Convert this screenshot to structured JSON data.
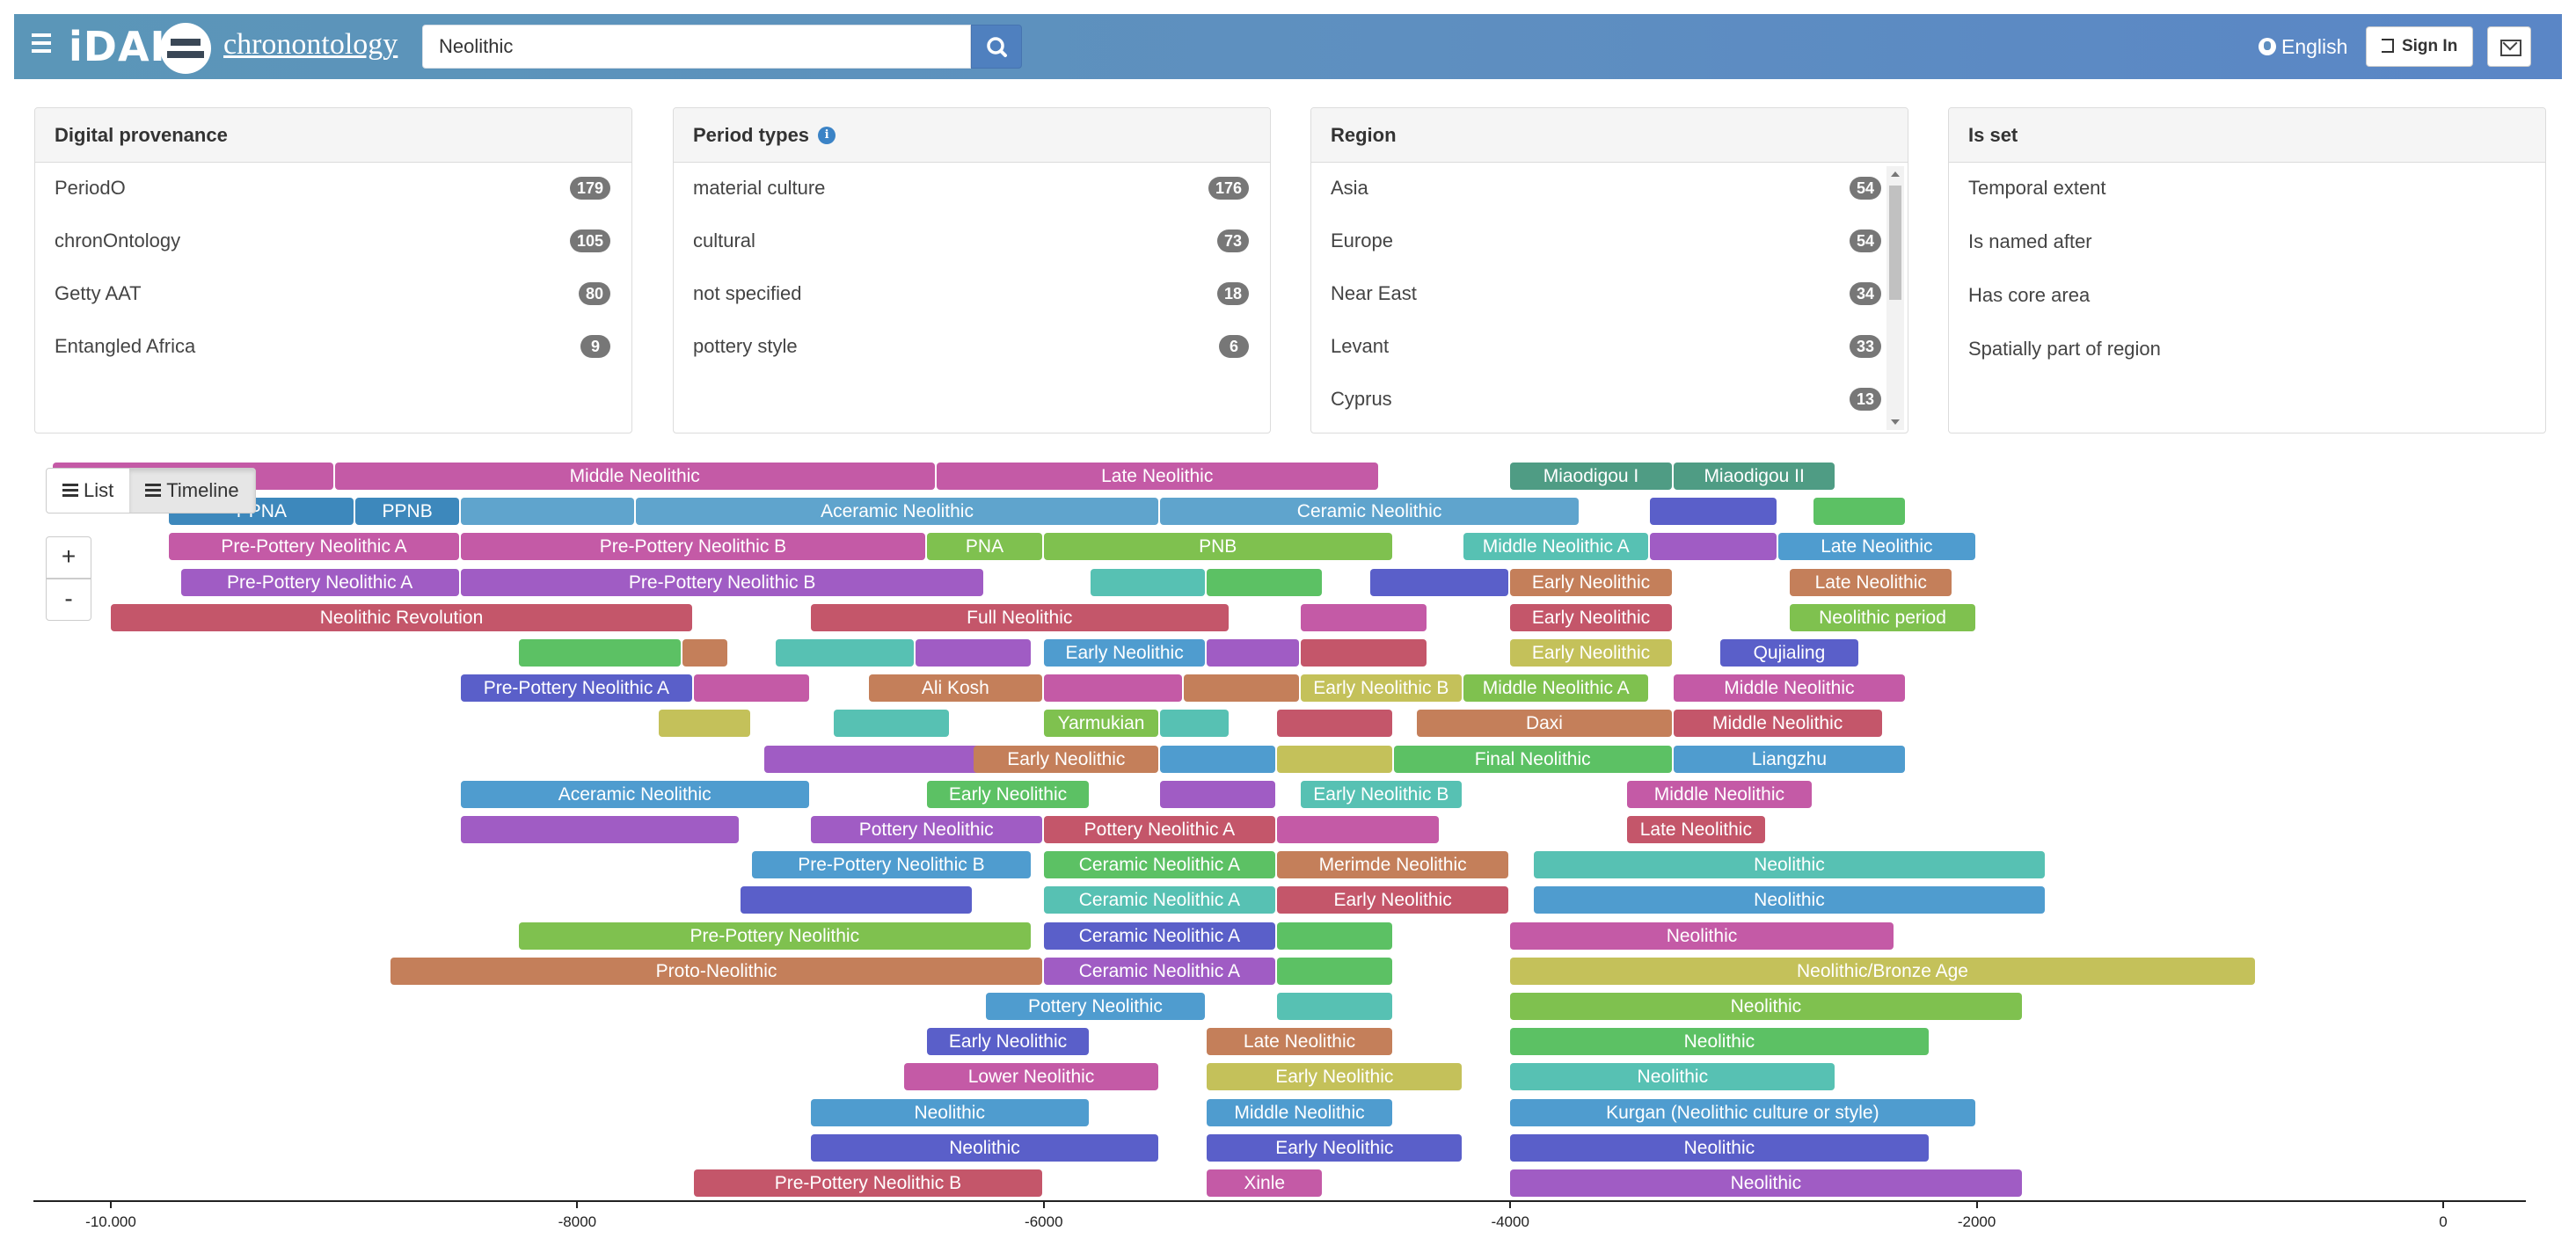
{
  "header": {
    "brand": "chronontology",
    "logo": "iDAI",
    "search_value": "Neolithic",
    "language": "English",
    "sign_in": "Sign In",
    "icons": [
      "menu-icon",
      "search-icon",
      "globe-icon",
      "sign-in-icon",
      "envelope-icon"
    ]
  },
  "facets": {
    "provenance": {
      "title": "Digital provenance",
      "items": [
        {
          "label": "PeriodO",
          "count": "179"
        },
        {
          "label": "chronOntology",
          "count": "105"
        },
        {
          "label": "Getty AAT",
          "count": "80"
        },
        {
          "label": "Entangled Africa",
          "count": "9"
        }
      ]
    },
    "period_types": {
      "title": "Period types",
      "items": [
        {
          "label": "material culture",
          "count": "176"
        },
        {
          "label": "cultural",
          "count": "73"
        },
        {
          "label": "not specified",
          "count": "18"
        },
        {
          "label": "pottery style",
          "count": "6"
        }
      ]
    },
    "region": {
      "title": "Region",
      "items": [
        {
          "label": "Asia",
          "count": "54"
        },
        {
          "label": "Europe",
          "count": "54"
        },
        {
          "label": "Near East",
          "count": "34"
        },
        {
          "label": "Levant",
          "count": "33"
        },
        {
          "label": "Cyprus",
          "count": "13"
        }
      ]
    },
    "is_set": {
      "title": "Is set",
      "items": [
        {
          "label": "Temporal extent"
        },
        {
          "label": "Is named after"
        },
        {
          "label": "Has core area"
        },
        {
          "label": "Spatially part of region"
        }
      ]
    }
  },
  "view": {
    "list_label": "List",
    "timeline_label": "Timeline",
    "zoom_in": "+",
    "zoom_out": "-"
  },
  "timeline": {
    "axis_ticks": [
      {
        "value": -10000,
        "label": "-10.000"
      },
      {
        "value": -8000,
        "label": "-8000"
      },
      {
        "value": -6000,
        "label": "-6000"
      },
      {
        "value": -4000,
        "label": "-4000"
      },
      {
        "value": -2000,
        "label": "-2000"
      },
      {
        "value": 0,
        "label": "0"
      }
    ],
    "rows": [
      [
        {
          "label": "",
          "start": -10250,
          "end": -9040,
          "color": "#c45aa6"
        },
        {
          "label": "Middle Neolithic",
          "start": -9040,
          "end": -6460,
          "color": "#c45aa6"
        },
        {
          "label": "Late Neolithic",
          "start": -6460,
          "end": -4560,
          "color": "#c45aa6"
        },
        {
          "label": "Miaodigou I",
          "start": -4000,
          "end": -3300,
          "color": "#4f9c84"
        },
        {
          "label": "Miaodigou II",
          "start": -3300,
          "end": -2600,
          "color": "#4f9c84"
        }
      ],
      [
        {
          "label": "PPNA",
          "start": -9750,
          "end": -8950,
          "color": "#3d88bc"
        },
        {
          "label": "PPNB",
          "start": -8950,
          "end": -8500,
          "color": "#3d88bc"
        },
        {
          "label": "",
          "start": -8500,
          "end": -7750,
          "color": "#5fa4cd"
        },
        {
          "label": "Aceramic Neolithic",
          "start": -7750,
          "end": -5500,
          "color": "#5fa4cd"
        },
        {
          "label": "Ceramic Neolithic",
          "start": -5500,
          "end": -3700,
          "color": "#5fa4cd"
        },
        {
          "label": "",
          "start": -3400,
          "end": -2850,
          "color": "#5a5fc9"
        },
        {
          "label": "",
          "start": -2700,
          "end": -2300,
          "color": "#5cc164"
        }
      ],
      [
        {
          "label": "Pre-Pottery Neolithic A",
          "start": -9750,
          "end": -8500,
          "color": "#c45aa6"
        },
        {
          "label": "Pre-Pottery Neolithic B",
          "start": -8500,
          "end": -6500,
          "color": "#c45aa6"
        },
        {
          "label": "PNA",
          "start": -6500,
          "end": -6000,
          "color": "#7fc14f"
        },
        {
          "label": "PNB",
          "start": -6000,
          "end": -4500,
          "color": "#7fc14f"
        },
        {
          "label": "Middle Neolithic A",
          "start": -4200,
          "end": -3400,
          "color": "#57c1b3"
        },
        {
          "label": "",
          "start": -3400,
          "end": -2850,
          "color": "#a05cc4"
        },
        {
          "label": "Late Neolithic",
          "start": -2850,
          "end": -2000,
          "color": "#4f9ccf"
        }
      ],
      [
        {
          "label": "Pre-Pottery Neolithic A",
          "start": -9700,
          "end": -8500,
          "color": "#a05cc4"
        },
        {
          "label": "Pre-Pottery Neolithic B",
          "start": -8500,
          "end": -6250,
          "color": "#a05cc4"
        },
        {
          "label": "",
          "start": -5800,
          "end": -5300,
          "color": "#57c1b3"
        },
        {
          "label": "",
          "start": -5300,
          "end": -4800,
          "color": "#5cc164"
        },
        {
          "label": "",
          "start": -4600,
          "end": -4000,
          "color": "#5a5fc9"
        },
        {
          "label": "Early Neolithic",
          "start": -4000,
          "end": -3300,
          "color": "#c47f5a"
        },
        {
          "label": "Late Neolithic",
          "start": -2800,
          "end": -2100,
          "color": "#c47f5a"
        }
      ],
      [
        {
          "label": "Neolithic Revolution",
          "start": -10000,
          "end": -7500,
          "color": "#c4566a"
        },
        {
          "label": "Full Neolithic",
          "start": -7000,
          "end": -5200,
          "color": "#c4566a"
        },
        {
          "label": "",
          "start": -4900,
          "end": -4350,
          "color": "#c45aa6"
        },
        {
          "label": "Early Neolithic",
          "start": -4000,
          "end": -3300,
          "color": "#c4566a"
        },
        {
          "label": "Neolithic period",
          "start": -2800,
          "end": -2000,
          "color": "#7fc14f"
        }
      ],
      [
        {
          "label": "",
          "start": -8250,
          "end": -7550,
          "color": "#5cc164"
        },
        {
          "label": "",
          "start": -7550,
          "end": -7350,
          "color": "#c47f5a"
        },
        {
          "label": "",
          "start": -7150,
          "end": -6550,
          "color": "#57c1b3"
        },
        {
          "label": "",
          "start": -6550,
          "end": -6050,
          "color": "#a05cc4"
        },
        {
          "label": "Early Neolithic",
          "start": -6000,
          "end": -5300,
          "color": "#4f9ccf"
        },
        {
          "label": "",
          "start": -5300,
          "end": -4900,
          "color": "#a05cc4"
        },
        {
          "label": "",
          "start": -4900,
          "end": -4350,
          "color": "#c4566a"
        },
        {
          "label": "Early Neolithic",
          "start": -4000,
          "end": -3300,
          "color": "#c4c15a"
        },
        {
          "label": "Qujialing",
          "start": -3100,
          "end": -2500,
          "color": "#5a5fc9"
        }
      ],
      [
        {
          "label": "Pre-Pottery Neolithic A",
          "start": -8500,
          "end": -7500,
          "color": "#5a5fc9"
        },
        {
          "label": "",
          "start": -7500,
          "end": -7000,
          "color": "#c45aa6"
        },
        {
          "label": "Ali Kosh",
          "start": -6750,
          "end": -6000,
          "color": "#c47f5a"
        },
        {
          "label": "",
          "start": -6000,
          "end": -5400,
          "color": "#c45aa6"
        },
        {
          "label": "",
          "start": -5400,
          "end": -4900,
          "color": "#c47f5a"
        },
        {
          "label": "Early Neolithic B",
          "start": -4900,
          "end": -4200,
          "color": "#c4c15a"
        },
        {
          "label": "Middle Neolithic A",
          "start": -4200,
          "end": -3400,
          "color": "#7fc14f"
        },
        {
          "label": "Middle Neolithic",
          "start": -3300,
          "end": -2300,
          "color": "#c45aa6"
        }
      ],
      [
        {
          "label": "",
          "start": -7650,
          "end": -7250,
          "color": "#c4c15a"
        },
        {
          "label": "",
          "start": -6900,
          "end": -6400,
          "color": "#57c1b3"
        },
        {
          "label": "Yarmukian",
          "start": -6000,
          "end": -5500,
          "color": "#7fc14f"
        },
        {
          "label": "",
          "start": -5500,
          "end": -5200,
          "color": "#57c1b3"
        },
        {
          "label": "",
          "start": -5000,
          "end": -4500,
          "color": "#c4566a"
        },
        {
          "label": "Daxi",
          "start": -4400,
          "end": -3300,
          "color": "#c47f5a"
        },
        {
          "label": "Middle Neolithic",
          "start": -3300,
          "end": -2400,
          "color": "#c4566a"
        }
      ],
      [
        {
          "label": "",
          "start": -7200,
          "end": -6200,
          "color": "#a05cc4"
        },
        {
          "label": "Early Neolithic",
          "start": -6300,
          "end": -5500,
          "color": "#c47f5a"
        },
        {
          "label": "",
          "start": -5500,
          "end": -5000,
          "color": "#4f9ccf"
        },
        {
          "label": "",
          "start": -5000,
          "end": -4500,
          "color": "#c4c15a"
        },
        {
          "label": "Final Neolithic",
          "start": -4500,
          "end": -3300,
          "color": "#5cc164"
        },
        {
          "label": "Liangzhu",
          "start": -3300,
          "end": -2300,
          "color": "#4f9ccf"
        }
      ],
      [
        {
          "label": "Aceramic Neolithic",
          "start": -8500,
          "end": -7000,
          "color": "#4f9ccf"
        },
        {
          "label": "Early Neolithic",
          "start": -6500,
          "end": -5800,
          "color": "#5cc164"
        },
        {
          "label": "",
          "start": -5500,
          "end": -5000,
          "color": "#a05cc4"
        },
        {
          "label": "Early Neolithic B",
          "start": -4900,
          "end": -4200,
          "color": "#57c1b3"
        },
        {
          "label": "Middle Neolithic",
          "start": -3500,
          "end": -2700,
          "color": "#c45aa6"
        }
      ],
      [
        {
          "label": "",
          "start": -8500,
          "end": -7300,
          "color": "#a05cc4"
        },
        {
          "label": "Pottery Neolithic",
          "start": -7000,
          "end": -6000,
          "color": "#a05cc4"
        },
        {
          "label": "Pottery Neolithic A",
          "start": -6000,
          "end": -5000,
          "color": "#c4566a"
        },
        {
          "label": "",
          "start": -5000,
          "end": -4300,
          "color": "#c45aa6"
        },
        {
          "label": "Late Neolithic",
          "start": -3500,
          "end": -2900,
          "color": "#c4566a"
        }
      ],
      [
        {
          "label": "Pre-Pottery Neolithic B",
          "start": -7250,
          "end": -6050,
          "color": "#4f9ccf"
        },
        {
          "label": "Ceramic Neolithic A",
          "start": -6000,
          "end": -5000,
          "color": "#5cc164"
        },
        {
          "label": "Merimde Neolithic",
          "start": -5000,
          "end": -4000,
          "color": "#c47f5a"
        },
        {
          "label": "Neolithic",
          "start": -3900,
          "end": -1700,
          "color": "#57c1b3"
        }
      ],
      [
        {
          "label": "",
          "start": -7300,
          "end": -6300,
          "color": "#5a5fc9"
        },
        {
          "label": "Ceramic Neolithic A",
          "start": -6000,
          "end": -5000,
          "color": "#57c1b3"
        },
        {
          "label": "Early Neolithic",
          "start": -5000,
          "end": -4000,
          "color": "#c4566a"
        },
        {
          "label": "Neolithic",
          "start": -3900,
          "end": -1700,
          "color": "#4f9ccf"
        }
      ],
      [
        {
          "label": "Pre-Pottery Neolithic",
          "start": -8250,
          "end": -6050,
          "color": "#7fc14f"
        },
        {
          "label": "Ceramic Neolithic A",
          "start": -6000,
          "end": -5000,
          "color": "#5a5fc9"
        },
        {
          "label": "",
          "start": -5000,
          "end": -4500,
          "color": "#5cc164"
        },
        {
          "label": "Neolithic",
          "start": -4000,
          "end": -2350,
          "color": "#c45aa6"
        }
      ],
      [
        {
          "label": "Proto-Neolithic",
          "start": -8800,
          "end": -6000,
          "color": "#c47f5a"
        },
        {
          "label": "Ceramic Neolithic A",
          "start": -6000,
          "end": -5000,
          "color": "#a05cc4"
        },
        {
          "label": "",
          "start": -5000,
          "end": -4500,
          "color": "#5cc164"
        },
        {
          "label": "Neolithic/Bronze Age",
          "start": -4000,
          "end": -800,
          "color": "#c4c15a"
        }
      ],
      [
        {
          "label": "Pottery Neolithic",
          "start": -6250,
          "end": -5300,
          "color": "#4f9ccf"
        },
        {
          "label": "",
          "start": -5000,
          "end": -4500,
          "color": "#57c1b3"
        },
        {
          "label": "Neolithic",
          "start": -4000,
          "end": -1800,
          "color": "#7fc14f"
        }
      ],
      [
        {
          "label": "Early Neolithic",
          "start": -6500,
          "end": -5800,
          "color": "#5a5fc9"
        },
        {
          "label": "Late Neolithic",
          "start": -5300,
          "end": -4500,
          "color": "#c47f5a"
        },
        {
          "label": "Neolithic",
          "start": -4000,
          "end": -2200,
          "color": "#5cc164"
        }
      ],
      [
        {
          "label": "Lower Neolithic",
          "start": -6600,
          "end": -5500,
          "color": "#c45aa6"
        },
        {
          "label": "Early Neolithic",
          "start": -5300,
          "end": -4200,
          "color": "#c4c15a"
        },
        {
          "label": "Neolithic",
          "start": -4000,
          "end": -2600,
          "color": "#57c1b3"
        }
      ],
      [
        {
          "label": "Neolithic",
          "start": -7000,
          "end": -5800,
          "color": "#4f9ccf"
        },
        {
          "label": "Middle Neolithic",
          "start": -5300,
          "end": -4500,
          "color": "#4f9ccf"
        },
        {
          "label": "Kurgan (Neolithic culture or style)",
          "start": -4000,
          "end": -2000,
          "color": "#4f9ccf"
        }
      ],
      [
        {
          "label": "Neolithic",
          "start": -7000,
          "end": -5500,
          "color": "#5a5fc9"
        },
        {
          "label": "Early Neolithic",
          "start": -5300,
          "end": -4200,
          "color": "#5a5fc9"
        },
        {
          "label": "Neolithic",
          "start": -4000,
          "end": -2200,
          "color": "#5a5fc9"
        }
      ],
      [
        {
          "label": "Pre-Pottery Neolithic B",
          "start": -7500,
          "end": -6000,
          "color": "#c4566a"
        },
        {
          "label": "Xinle",
          "start": -5300,
          "end": -4800,
          "color": "#c45aa6"
        },
        {
          "label": "Neolithic",
          "start": -4000,
          "end": -1800,
          "color": "#a05cc4"
        }
      ]
    ]
  }
}
